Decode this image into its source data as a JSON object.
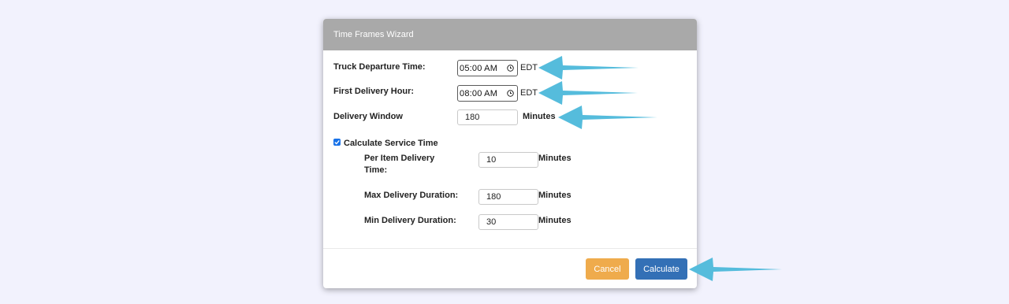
{
  "dialog": {
    "title": "Time Frames Wizard"
  },
  "form": {
    "truck_departure": {
      "label": "Truck Departure Time:",
      "value": "05:00 AM",
      "timezone": "EDT"
    },
    "first_delivery": {
      "label": "First Delivery Hour:",
      "value": "08:00 AM",
      "timezone": "EDT"
    },
    "delivery_window": {
      "label": "Delivery Window",
      "value": "180",
      "unit": "Minutes"
    },
    "calculate_service_time": {
      "label": "Calculate Service Time",
      "checked": true
    },
    "per_item": {
      "label_line1": "Per Item Delivery",
      "label_line2": "Time:",
      "value": "10",
      "unit": "Minutes"
    },
    "max_duration": {
      "label": "Max Delivery Duration:",
      "value": "180",
      "unit": "Minutes"
    },
    "min_duration": {
      "label": "Min Delivery Duration:",
      "value": "30",
      "unit": "Minutes"
    }
  },
  "footer": {
    "cancel_label": "Cancel",
    "calculate_label": "Calculate"
  },
  "colors": {
    "header": "#a9a9a9",
    "cancel": "#efab4c",
    "calculate": "#3370b6",
    "annotation_arrow": "#55bcdc",
    "checkbox": "#1a73e8"
  },
  "icons": [
    "clock-icon",
    "checkbox-checked-icon",
    "annotation-arrow"
  ]
}
